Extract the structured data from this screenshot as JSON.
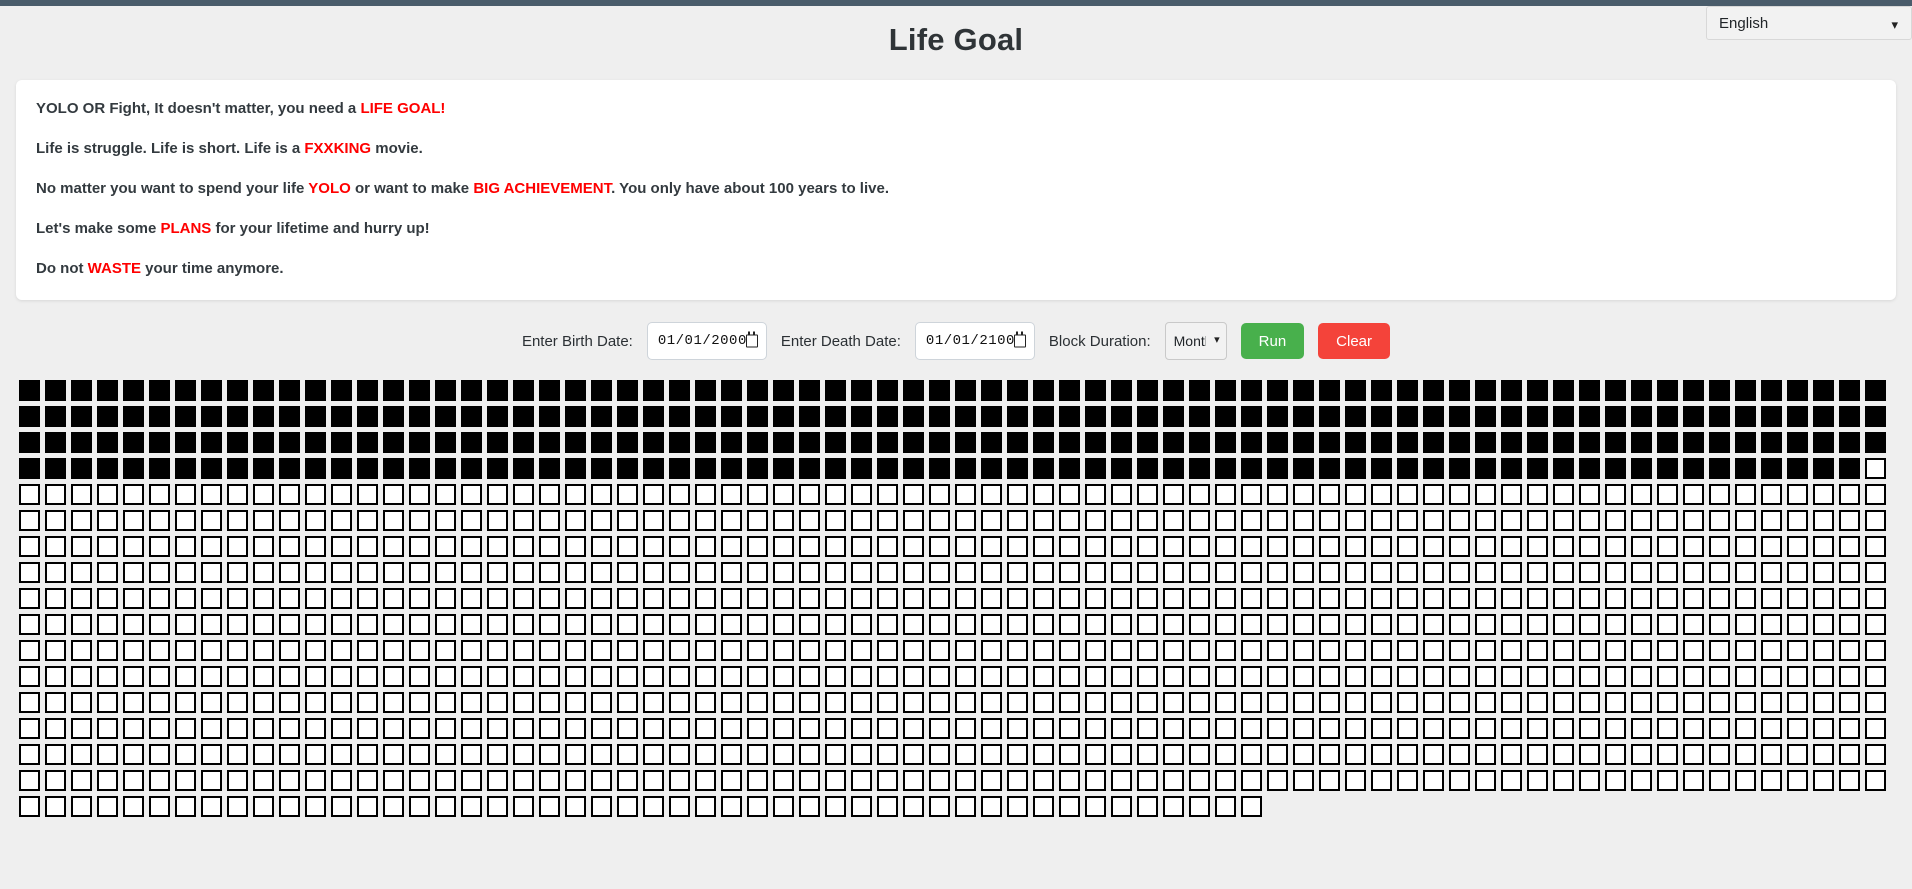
{
  "topbar": {
    "color": "#4a5c6b"
  },
  "language": {
    "selected": "English",
    "options": [
      "English"
    ],
    "chevron_icon": "chevron-down-icon"
  },
  "header": {
    "title": "Life Goal"
  },
  "intro": {
    "lines": [
      {
        "parts": [
          {
            "text": "YOLO OR Fight, It doesn't matter, you need a ",
            "highlight": false
          },
          {
            "text": "LIFE GOAL!",
            "highlight": true
          }
        ]
      },
      {
        "parts": [
          {
            "text": "Life is struggle. Life is short. Life is a ",
            "highlight": false
          },
          {
            "text": "FXXKING",
            "highlight": true
          },
          {
            "text": " movie.",
            "highlight": false
          }
        ]
      },
      {
        "parts": [
          {
            "text": "No matter you want to spend your life ",
            "highlight": false
          },
          {
            "text": "YOLO",
            "highlight": true
          },
          {
            "text": " or want to make ",
            "highlight": false
          },
          {
            "text": "BIG ACHIEVEMENT",
            "highlight": true
          },
          {
            "text": ". You only have about 100 years to live.",
            "highlight": false
          }
        ]
      },
      {
        "parts": [
          {
            "text": "Let's make some ",
            "highlight": false
          },
          {
            "text": "PLANS",
            "highlight": true
          },
          {
            "text": " for your lifetime and hurry up!",
            "highlight": false
          }
        ]
      },
      {
        "parts": [
          {
            "text": "Do not ",
            "highlight": false
          },
          {
            "text": "WASTE",
            "highlight": true
          },
          {
            "text": " your time anymore.",
            "highlight": false
          }
        ]
      }
    ],
    "highlight_color": "#ff0000"
  },
  "controls": {
    "birth_label": "Enter Birth Date:",
    "birth_value": "01/01/2000",
    "death_label": "Enter Death Date:",
    "death_value": "01/01/2100",
    "duration_label": "Block Duration:",
    "duration_value": "Month",
    "duration_options": [
      "Month"
    ],
    "run_label": "Run",
    "clear_label": "Clear",
    "run_color": "#48b04c",
    "clear_color": "#f4433a",
    "calendar_icon": "calendar-icon",
    "chevron_icon": "chevron-down-icon"
  },
  "grid": {
    "columns": 70,
    "total_blocks": 1200,
    "filled_blocks": 287,
    "block_size_px": 21,
    "filled_color": "#000000",
    "empty_color": "#ffffff",
    "border_color": "#000000"
  }
}
